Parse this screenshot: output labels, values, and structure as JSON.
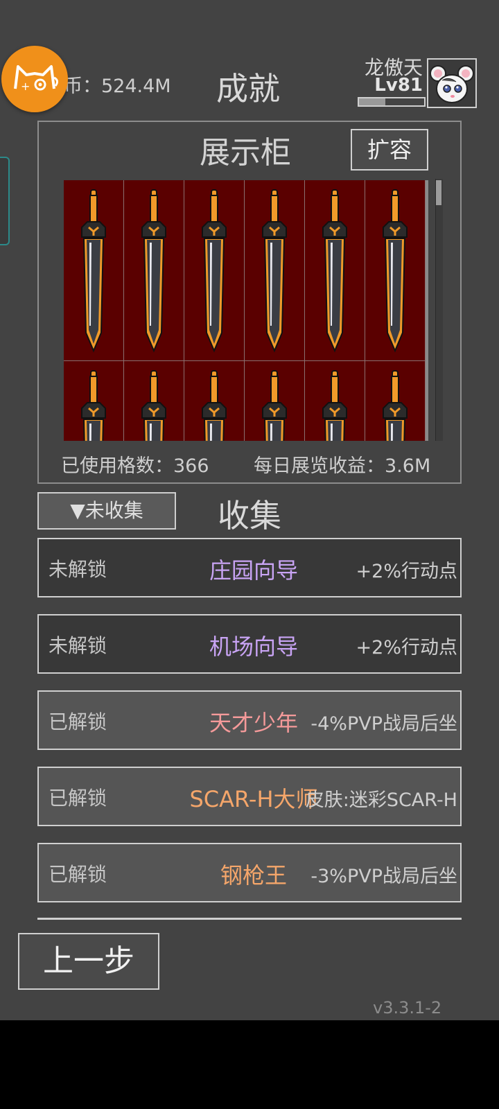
{
  "header": {
    "coin_label": "币：524.4M",
    "title": "成就",
    "player_name": "龙傲天",
    "player_level": "Lv81",
    "xp_fraction": 0.4
  },
  "showcase": {
    "title": "展示柜",
    "expand_button": "扩容",
    "item_icon": "sword-icon",
    "used_slots_label": "已使用格数：366",
    "daily_income_label": "每日展览收益：3.6M"
  },
  "collection": {
    "filter_button": "▼未收集",
    "title": "收集",
    "items": [
      {
        "status": "未解锁",
        "name": "庄园向导",
        "reward": "+2%行动点",
        "name_color": "#c9a4f5",
        "unlocked": false
      },
      {
        "status": "未解锁",
        "name": "机场向导",
        "reward": "+2%行动点",
        "name_color": "#c9a4f5",
        "unlocked": false
      },
      {
        "status": "已解锁",
        "name": "天才少年",
        "reward": "-4%PVP战局后坐",
        "name_color": "#f59a9a",
        "unlocked": true
      },
      {
        "status": "已解锁",
        "name": "SCAR-H大师",
        "reward": "皮肤:迷彩SCAR-H",
        "name_color": "#f5a66a",
        "unlocked": true
      },
      {
        "status": "已解锁",
        "name": "钢枪王",
        "reward": "-3%PVP战局后坐",
        "name_color": "#f5a66a",
        "unlocked": true
      }
    ]
  },
  "footer": {
    "back_button": "上一步",
    "version": "v3.3.1-2"
  }
}
